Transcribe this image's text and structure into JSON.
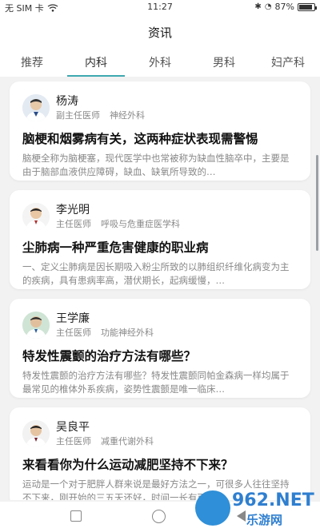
{
  "status_bar": {
    "carrier": "无 SIM 卡",
    "time": "11:27",
    "battery": "87%",
    "battery_level": 0.87,
    "icons": [
      "wifi-icon",
      "bluetooth-icon",
      "alarm-icon",
      "battery-icon"
    ]
  },
  "header": {
    "title": "资讯"
  },
  "tabs": [
    {
      "label": "推荐",
      "active": false
    },
    {
      "label": "内科",
      "active": true
    },
    {
      "label": "外科",
      "active": false
    },
    {
      "label": "男科",
      "active": false
    },
    {
      "label": "妇产科",
      "active": false
    }
  ],
  "articles": [
    {
      "doctor_name": "杨涛",
      "doctor_title": "副主任医师",
      "department": "神经外科",
      "title": "脑梗和烟雾病有关，这两种症状表现需警惕",
      "summary": "脑梗全称为脑梗塞，现代医学中也常被称为缺血性脑卒中，主要是由于脑部血液供应障碍，缺血、缺氧所导致的…"
    },
    {
      "doctor_name": "李光明",
      "doctor_title": "主任医师",
      "department": "呼吸与危重症医学科",
      "title": "尘肺病一种严重危害健康的职业病",
      "summary": "一、定义尘肺病是因长期吸入粉尘所致的以肺组织纤维化病变为主的疾病，具有患病率高，潜伏期长，起病缓慢，…"
    },
    {
      "doctor_name": "王学廉",
      "doctor_title": "主任医师",
      "department": "功能神经外科",
      "title": "特发性震颤的治疗方法有哪些？",
      "summary": "特发性震颤的治疗方法有哪些？特发性震颤同帕金森病一样均属于最常见的椎体外系疾病，姿势性震颤是唯一临床…"
    },
    {
      "doctor_name": "吴良平",
      "doctor_title": "主任医师",
      "department": "减重代谢外科",
      "title": "来看看你为什么运动减肥坚持不下来？",
      "summary": "运动是一个对于肥胖人群来说是最好方法之一，可很多人往往坚持不下来，刚开始的三五天还好，时间一长有可能…"
    }
  ],
  "watermark": {
    "line1": "962.NET",
    "line2": "乐游网"
  },
  "colors": {
    "accent": "#3ea8b0",
    "background": "#f2f2f2",
    "watermark": "#2f7fd0"
  }
}
